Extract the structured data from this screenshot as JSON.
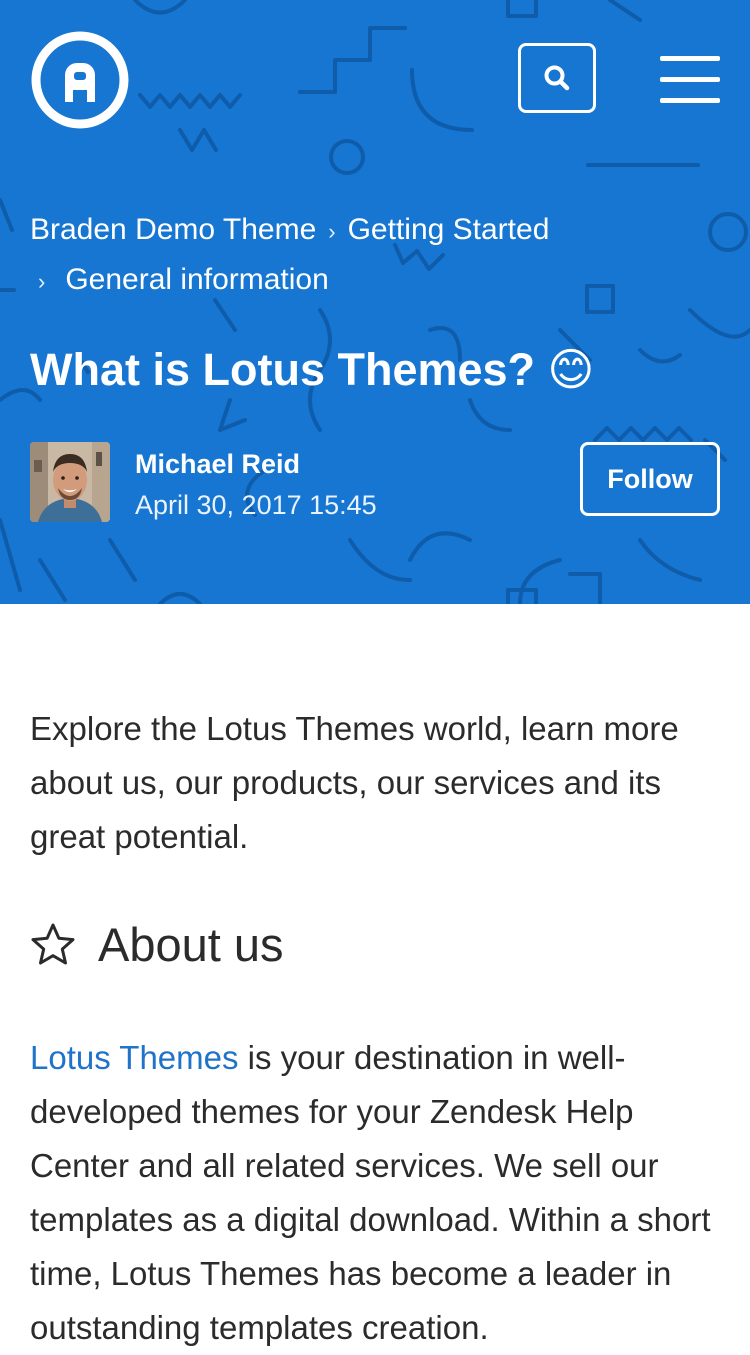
{
  "colors": {
    "hero_background": "#1676d2",
    "hero_pattern": "#0f5cab",
    "link": "#1f73c9",
    "text": "#2b2b2b"
  },
  "header": {
    "logo_letter": "A",
    "search_icon": "search-icon",
    "menu_icon": "hamburger-menu-icon"
  },
  "breadcrumb": {
    "items": [
      "Braden Demo Theme",
      "Getting Started",
      "General information"
    ],
    "separator": "›"
  },
  "article": {
    "title": "What is Lotus Themes? 😊",
    "author": {
      "name": "Michael Reid",
      "date": "April 30, 2017 15:45"
    },
    "follow_label": "Follow",
    "intro": "Explore the Lotus Themes world, learn more about us, our products, our services and its great potential.",
    "section": {
      "icon": "star-outline-icon",
      "heading": "About us"
    },
    "body": {
      "link_text": "Lotus Themes",
      "text": " is your destination in well-developed themes for your Zendesk Help Center and all related services. We sell our templates as a digital download. Within a short time, Lotus Themes has become a leader in outstanding templates creation."
    }
  }
}
